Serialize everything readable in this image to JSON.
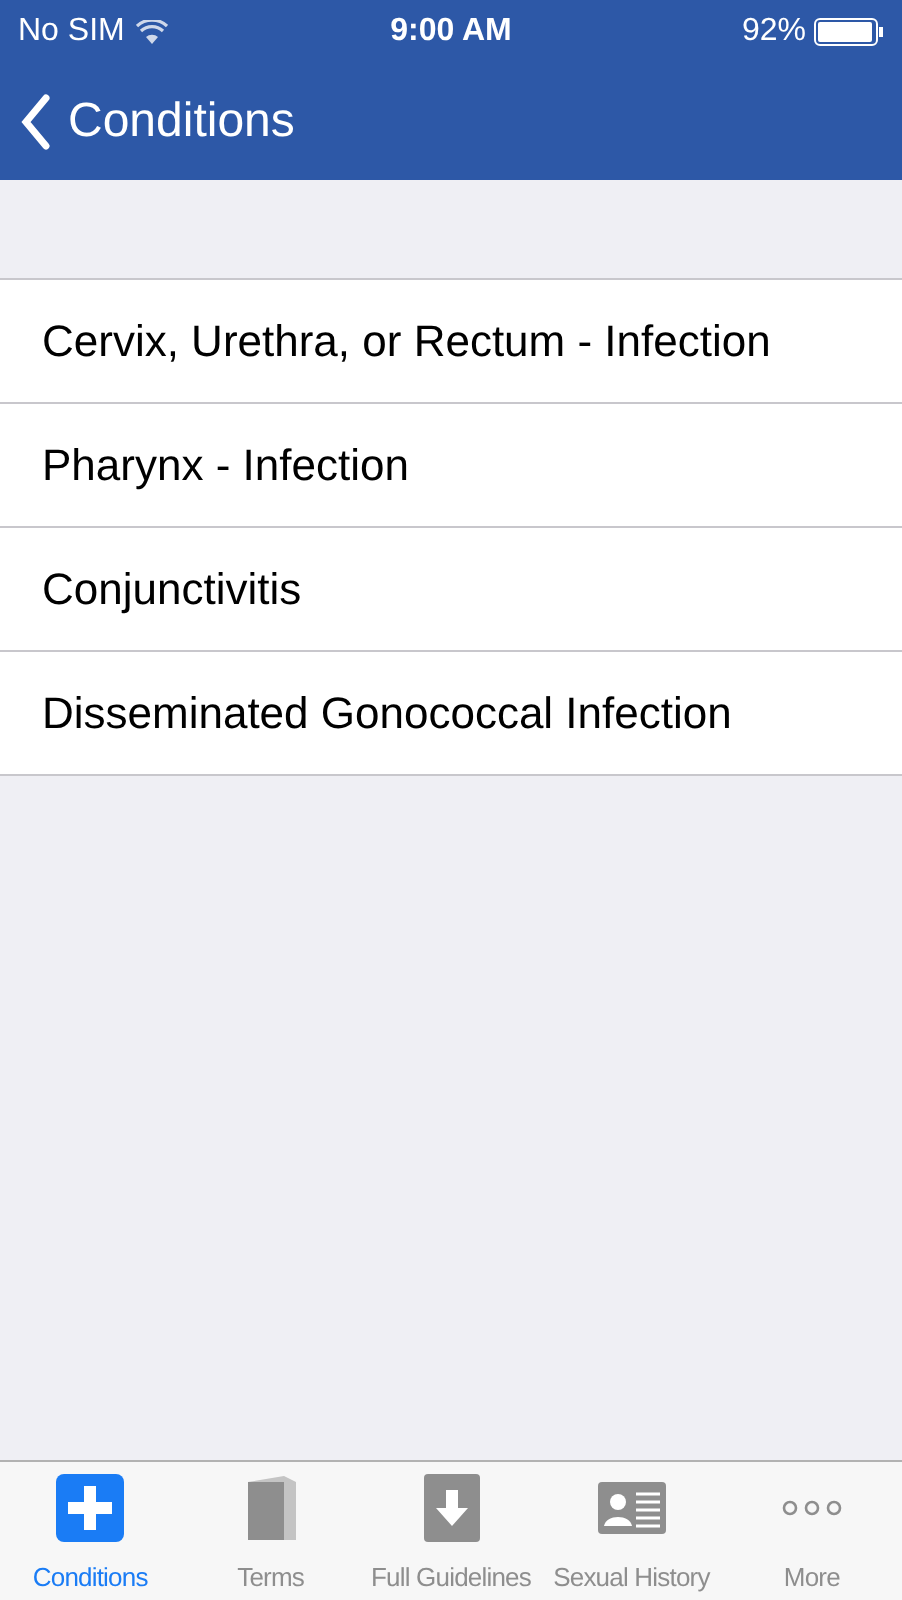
{
  "status_bar": {
    "carrier": "No SIM",
    "time": "9:00 AM",
    "battery": "92%"
  },
  "nav_bar": {
    "back_label": "Conditions"
  },
  "conditions": [
    {
      "label": "Cervix, Urethra, or Rectum - Infection"
    },
    {
      "label": "Pharynx - Infection"
    },
    {
      "label": "Conjunctivitis"
    },
    {
      "label": "Disseminated Gonococcal Infection"
    }
  ],
  "tab_bar": [
    {
      "label": "Conditions",
      "kind": "plus",
      "selected": true
    },
    {
      "label": "Terms",
      "kind": "book",
      "selected": false
    },
    {
      "label": "Full Guidelines",
      "kind": "download",
      "selected": false
    },
    {
      "label": "Sexual History",
      "kind": "contact",
      "selected": false
    },
    {
      "label": "More",
      "kind": "more",
      "selected": false
    }
  ]
}
